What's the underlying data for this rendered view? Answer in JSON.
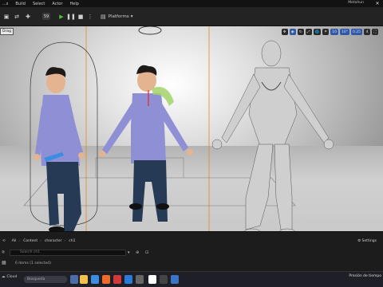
{
  "menubar": {
    "items": [
      "...s",
      "Build",
      "Select",
      "Actor",
      "Help"
    ],
    "window_title": "Metahun"
  },
  "toolbar": {
    "badge": "59",
    "platforms_label": "Platforms",
    "accent_play": "#4fbf3a"
  },
  "viewport": {
    "tooltip": "Drag",
    "tools": {
      "snap_value": "10",
      "rotate_value": "10°",
      "scale_value": "0.25",
      "camera_speed": "4"
    }
  },
  "content_browser": {
    "breadcrumbs": [
      "All",
      "Content",
      "character",
      "ch1"
    ],
    "search_placeholder": "Search ch1",
    "status": "6 items (1 selected)",
    "settings_label": "Settings"
  },
  "taskbar": {
    "weather": "Cloud",
    "search_placeholder": "Búsqueda",
    "tray_text": "Presión de tiempo"
  },
  "colors": {
    "viewport_bg": "#c8c8c8",
    "selection_orange": "#e58a1a",
    "mannequin": "#cfcfcf"
  }
}
